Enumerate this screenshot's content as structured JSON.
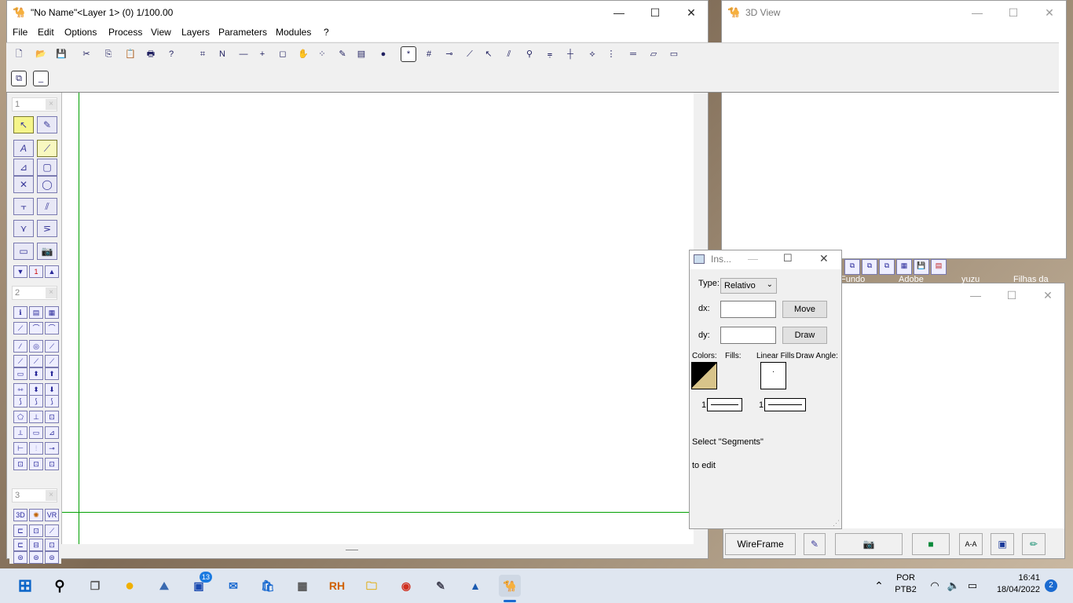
{
  "main_window": {
    "title": "\"No Name\"<Layer 1> (0) 1/100.00",
    "menu": [
      "File",
      "Edit",
      "Options",
      "Process",
      "View",
      "Layers",
      "Parameters",
      "Modules",
      "?"
    ],
    "minimize": "—",
    "maximize": "☐",
    "close": "✕"
  },
  "toolbar": {
    "row1": [
      "🗋",
      "📂",
      "💾",
      "✂",
      "⎘",
      "📋",
      "🖶",
      "?",
      "⌗",
      "N",
      "—",
      "+",
      "◻",
      "✋",
      "⁘",
      "✎",
      "▤",
      "●",
      "*",
      "#",
      "⊸",
      "⟋",
      "↖",
      "⫽",
      "⚲",
      "⩦",
      "┼",
      "⟡",
      "⋮",
      "═",
      "▱",
      "▭"
    ],
    "row2": [
      "⧉",
      "_"
    ]
  },
  "palette": {
    "header1": "1",
    "header2": "2",
    "header3": "3",
    "layer_number": "1",
    "vr_label": "VR",
    "label_3d": "3D"
  },
  "view3d": {
    "title": "3D View",
    "minimize": "—",
    "maximize": "☐",
    "close": "✕"
  },
  "inspector": {
    "title": "Ins...",
    "type_label": "Type:",
    "type_value": "Relativo",
    "dx_label": "dx:",
    "dy_label": "dy:",
    "dx_value": "",
    "dy_value": "",
    "move_button": "Move",
    "draw_button": "Draw",
    "colors_label": "Colors:",
    "fills_label": "Fills:",
    "linear_fills_label": "Linear Fills",
    "draw_angle_label": "Draw Angle:",
    "line1_num": "1",
    "line2_num": "1",
    "hint_line1": "Select \"Segments\"",
    "hint_line2": "to edit",
    "colors": {
      "fg": "#000000",
      "bg": "#d8c48a"
    }
  },
  "back_window": {
    "desktop_labels": [
      "Fundo",
      "Adobe",
      "yuzu",
      "Filhas da"
    ],
    "wireframe_button": "WireFrame"
  },
  "taskbar": {
    "badge_count": "13",
    "rh_label": "RH",
    "lang_line1": "POR",
    "lang_line2": "PTB2",
    "time": "16:41",
    "date": "18/04/2022",
    "notification_count": "2"
  }
}
